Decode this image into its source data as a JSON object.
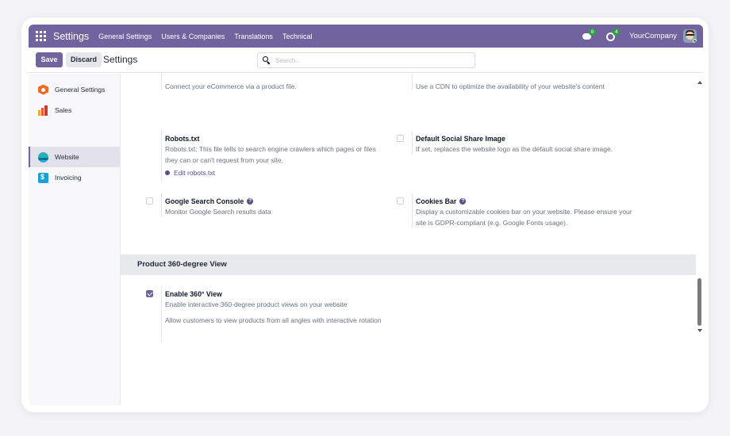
{
  "topnav": {
    "brand": "Settings",
    "menu": [
      "General Settings",
      "Users & Companies",
      "Translations",
      "Technical"
    ],
    "messages_badge": "8",
    "activities_badge": "4",
    "company": "YourCompany"
  },
  "controlbar": {
    "save_label": "Save",
    "discard_label": "Discard",
    "title": "Settings",
    "search_placeholder": "Search..."
  },
  "sidebar": {
    "items": [
      {
        "label": "General Settings",
        "icon": "general-settings-icon",
        "active": false
      },
      {
        "label": "Sales",
        "icon": "sales-icon",
        "active": false
      },
      {
        "label": "Website",
        "icon": "website-icon",
        "active": true
      },
      {
        "label": "Invoicing",
        "icon": "invoicing-icon",
        "active": false
      }
    ]
  },
  "settings": {
    "product_file_desc": "Connect your eCommerce via a product file.",
    "cdn_desc": "Use a CDN to optimize the availability of your website's content",
    "robots": {
      "title": "Robots.txt",
      "desc": "Robots.txt: This file tells to search engine crawlers which pages or files they can or can't request from your site.",
      "link": "Edit robots.txt"
    },
    "social_image": {
      "title": "Default Social Share Image",
      "desc": "If set, replaces the website logo as the default social share image."
    },
    "google_console": {
      "title": "Google Search Console",
      "desc": "Monitor Google Search results data"
    },
    "cookies_bar": {
      "title": "Cookies Bar",
      "desc": "Display a customizable cookies bar on your website. Please ensure your site is GDPR-compliant (e.g. Google Fonts usage)."
    }
  },
  "section": {
    "title": "Product 360-degree View",
    "enable": {
      "title": "Enable 360° View",
      "desc": "Enable interactive 360-degree product views on your website",
      "note": "Allow customers to view products from all angles with interactive rotation",
      "checked": true
    }
  },
  "colors": {
    "brand": "#71639e",
    "badge": "#2ea043"
  }
}
